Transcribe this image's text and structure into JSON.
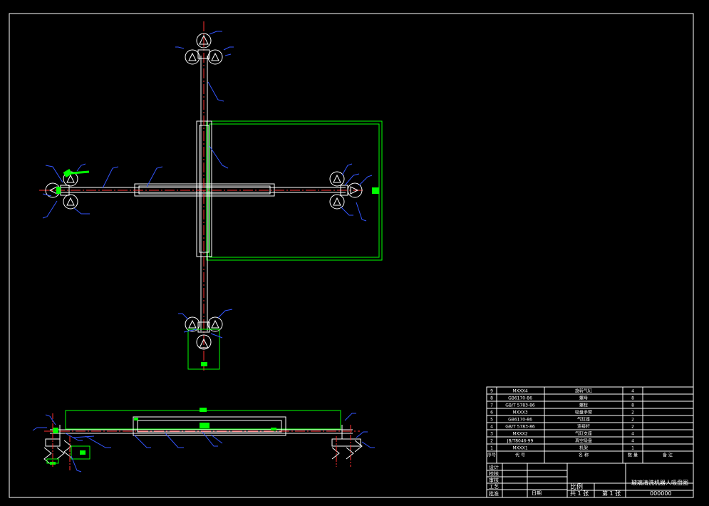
{
  "colors": {
    "background": "#000000",
    "frame": "#ffffff",
    "part_outline": "#ffffff",
    "guard_frame": "#00ff00",
    "centerline": "#ff3030",
    "leader": "#3355ff",
    "highlight": "#00ff00"
  },
  "bom": {
    "rows": [
      {
        "no": "9",
        "code": "MXXX4",
        "name": "旋转气缸",
        "qty": "4",
        "note": ""
      },
      {
        "no": "8",
        "code": "GB6170-86",
        "name": "螺母",
        "qty": "8",
        "note": ""
      },
      {
        "no": "7",
        "code": "GB/T 5783-86",
        "name": "螺栓",
        "qty": "8",
        "note": ""
      },
      {
        "no": "6",
        "code": "MXXX3",
        "name": "吸盘手臂",
        "qty": "2",
        "note": ""
      },
      {
        "no": "5",
        "code": "GB6170-86",
        "name": "气缸座",
        "qty": "2",
        "note": ""
      },
      {
        "no": "4",
        "code": "GB/T 5783-86",
        "name": "连接杆",
        "qty": "2",
        "note": ""
      },
      {
        "no": "3",
        "code": "MXXX2",
        "name": "气缸支座",
        "qty": "4",
        "note": ""
      },
      {
        "no": "2",
        "code": "JB/T8046-99",
        "name": "真空吸盘",
        "qty": "4",
        "note": ""
      },
      {
        "no": "1",
        "code": "MXXX1",
        "name": "机架",
        "qty": "1",
        "note": ""
      }
    ],
    "header": {
      "no": "序号",
      "code": "代 号",
      "name": "名 称",
      "qty": "数 量",
      "note": "备 注"
    }
  },
  "title_block": {
    "left_labels": [
      "设计",
      "校核",
      "审核",
      "工艺",
      "批准"
    ],
    "date_label": "日期",
    "scale_label": "比例",
    "sheet_total": "共 1 张",
    "sheet_no": "第 1 张",
    "drawing_title": "玻璃清洗机器人吸盘图",
    "drawing_no": "000000"
  }
}
